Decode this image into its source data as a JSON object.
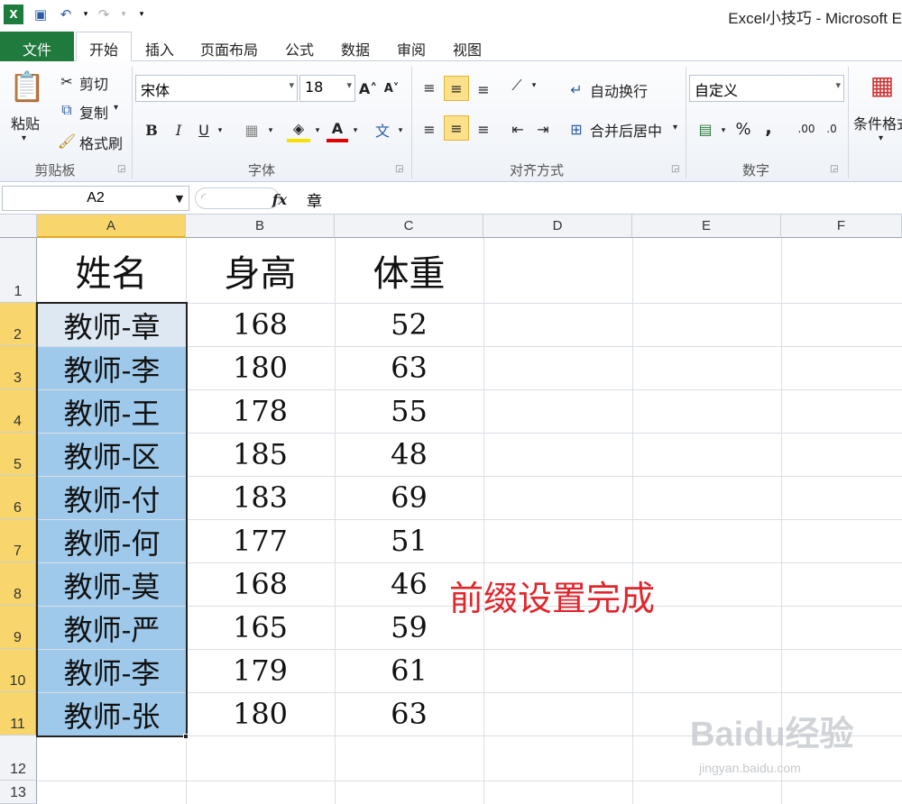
{
  "titlebar": {
    "title": "Excel小技巧 - Microsoft E"
  },
  "tabs": [
    "文件",
    "开始",
    "插入",
    "页面布局",
    "公式",
    "数据",
    "审阅",
    "视图"
  ],
  "ribbon": {
    "clipboard": {
      "paste": "粘贴",
      "cut": "剪切",
      "copy": "复制",
      "format_painter": "格式刷",
      "label": "剪贴板"
    },
    "font": {
      "name": "宋体",
      "size": "18",
      "bold": "B",
      "italic": "I",
      "underline": "U",
      "label": "字体"
    },
    "alignment": {
      "wrap": "自动换行",
      "merge": "合并后居中",
      "label": "对齐方式"
    },
    "number": {
      "format": "自定义",
      "percent": "%",
      "comma": ",",
      "label": "数字"
    },
    "styles": {
      "conditional": "条件格式"
    }
  },
  "formula_bar": {
    "name_box": "A2",
    "fx": "fx",
    "content": "章"
  },
  "grid": {
    "columns": [
      "A",
      "B",
      "C",
      "D",
      "E",
      "F"
    ],
    "rows": [
      "1",
      "2",
      "3",
      "4",
      "5",
      "6",
      "7",
      "8",
      "9",
      "10",
      "11",
      "12",
      "13"
    ],
    "header": [
      "姓名",
      "身高",
      "体重"
    ],
    "data": [
      [
        "教师-章",
        "168",
        "52"
      ],
      [
        "教师-李",
        "180",
        "63"
      ],
      [
        "教师-王",
        "178",
        "55"
      ],
      [
        "教师-区",
        "185",
        "48"
      ],
      [
        "教师-付",
        "183",
        "69"
      ],
      [
        "教师-何",
        "177",
        "51"
      ],
      [
        "教师-莫",
        "168",
        "46"
      ],
      [
        "教师-严",
        "165",
        "59"
      ],
      [
        "教师-李",
        "179",
        "61"
      ],
      [
        "教师-张",
        "180",
        "63"
      ]
    ],
    "note": "前缀设置完成"
  },
  "watermark": {
    "brand": "Baidu经验",
    "url": "jingyan.baidu.com"
  },
  "colors": {
    "file_tab": "#1f7a3d",
    "selection": "#9ec9ea",
    "header_highlight": "#f8d66b",
    "note": "#e0262b"
  }
}
